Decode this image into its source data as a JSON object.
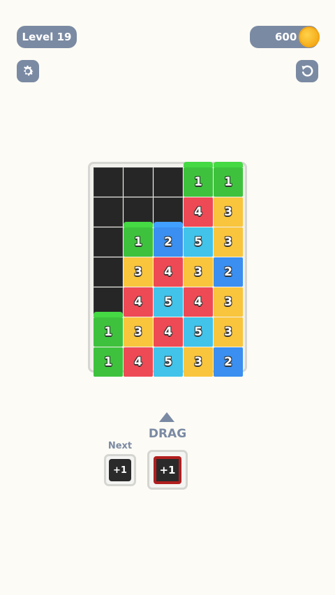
{
  "header": {
    "level_label": "Level 19",
    "coins": "600",
    "coin_icon": "coin-icon",
    "settings_icon": "gear-icon",
    "undo_icon": "undo-icon"
  },
  "colors": {
    "1": "#3ec23d",
    "2": "#3a8ff0",
    "3": "#f9c53d",
    "4": "#ee4a55",
    "5": "#41c3ea",
    "empty": "#262626",
    "ui": "#7b8aa3"
  },
  "board": {
    "rows": [
      [
        null,
        null,
        null,
        "1",
        "1"
      ],
      [
        null,
        null,
        null,
        "4",
        "3"
      ],
      [
        null,
        "1",
        "2",
        "5",
        "3"
      ],
      [
        null,
        "3",
        "4",
        "3",
        "2"
      ],
      [
        null,
        "4",
        "5",
        "4",
        "3"
      ],
      [
        "1",
        "3",
        "4",
        "5",
        "3"
      ],
      [
        "1",
        "4",
        "5",
        "3",
        "2"
      ]
    ]
  },
  "controls": {
    "drag_label": "DRAG",
    "next_label": "Next",
    "next_piece": "+1",
    "drag_piece": "+1"
  }
}
